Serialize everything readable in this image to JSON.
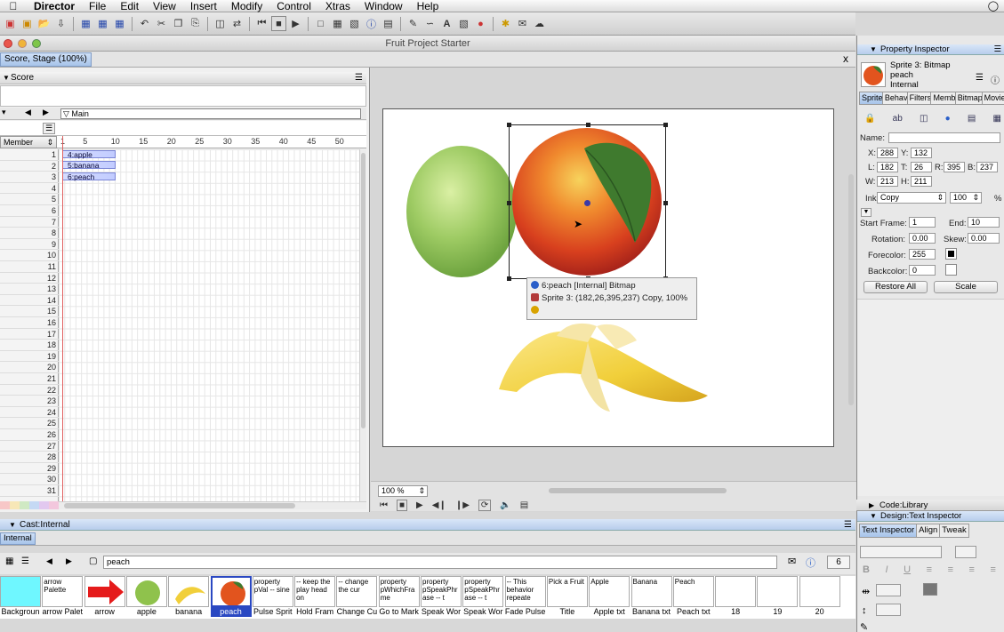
{
  "menubar": {
    "app": "Director",
    "items": [
      "File",
      "Edit",
      "View",
      "Insert",
      "Modify",
      "Control",
      "Xtras",
      "Window",
      "Help"
    ]
  },
  "window": {
    "title": "Fruit Project Starter"
  },
  "doc_tab": "Score, Stage (100%)",
  "doc_close": "x",
  "score": {
    "title": "Score",
    "marker": "Main",
    "member_btn": "Member",
    "frame_numbers": [
      "1",
      "5",
      "10",
      "15",
      "20",
      "25",
      "30",
      "35",
      "40",
      "45",
      "50"
    ],
    "channels": [
      "1",
      "2",
      "3",
      "4",
      "5",
      "6",
      "7",
      "8",
      "9",
      "10",
      "11",
      "12",
      "13",
      "14",
      "15",
      "16",
      "17",
      "18",
      "19",
      "20",
      "21",
      "22",
      "23",
      "24",
      "25",
      "26",
      "27",
      "28",
      "29",
      "30",
      "31"
    ],
    "sprites": [
      "4:apple",
      "5:banana",
      "6:peach"
    ]
  },
  "stage": {
    "zoom": "100 %",
    "tooltip": {
      "line1": "6:peach [Internal] Bitmap",
      "line2": "Sprite 3: (182,26,395,237) Copy, 100%"
    }
  },
  "property_inspector": {
    "title": "Property Inspector",
    "sprite_label": "Sprite 3: Bitmap",
    "member_name": "peach",
    "cast_name": "Internal",
    "tabs": [
      "Sprite",
      "Behav",
      "Filters",
      "Memb",
      "Bitmap",
      "Movie"
    ],
    "name_label": "Name:",
    "x_label": "X:",
    "x": "288",
    "y_label": "Y:",
    "y": "132",
    "l_label": "L:",
    "l": "182",
    "t_label": "T:",
    "t": "26",
    "r_label": "R:",
    "r": "395",
    "b_label": "B:",
    "b": "237",
    "w_label": "W:",
    "w": "213",
    "h_label": "H:",
    "h": "211",
    "ink_label": "Ink:",
    "ink": "Copy",
    "blend": "100",
    "blend_unit": "%",
    "start_label": "Start Frame:",
    "start": "1",
    "end_label": "End:",
    "end": "10",
    "rot_label": "Rotation:",
    "rotation": "0.00",
    "skew_label": "Skew:",
    "skew": "0.00",
    "fore_label": "Forecolor:",
    "forecolor": "255",
    "back_label": "Backcolor:",
    "backcolor": "0",
    "restore_btn": "Restore All",
    "scale_btn": "Scale"
  },
  "code_library": "Code:Library",
  "text_inspector": {
    "title": "Design:Text Inspector",
    "tabs": [
      "Text Inspector",
      "Align",
      "Tweak"
    ]
  },
  "cast": {
    "title": "Cast:Internal",
    "tab": "Internal",
    "search": "peach",
    "count": "6",
    "members": [
      {
        "name": "Backgroun",
        "thumb": ""
      },
      {
        "name": "arrow Palet",
        "thumb": "arrow Palette"
      },
      {
        "name": "arrow",
        "thumb": ""
      },
      {
        "name": "apple",
        "thumb": ""
      },
      {
        "name": "banana",
        "thumb": ""
      },
      {
        "name": "peach",
        "thumb": ""
      },
      {
        "name": "Pulse Sprit",
        "thumb": "property pVal -- sine"
      },
      {
        "name": "Hold Fram",
        "thumb": "-- keep the play head on"
      },
      {
        "name": "Change Cu",
        "thumb": "-- change the cur"
      },
      {
        "name": "Go to Mark",
        "thumb": "property pWhichFra me"
      },
      {
        "name": "Speak Wor",
        "thumb": "property pSpeakPhr ase -- t"
      },
      {
        "name": "Speak Wor",
        "thumb": "property pSpeakPhr ase -- t"
      },
      {
        "name": "Fade Pulse",
        "thumb": "-- This behavior repeate"
      },
      {
        "name": "Title",
        "thumb": "Pick a Fruit"
      },
      {
        "name": "Apple txt",
        "thumb": "Apple"
      },
      {
        "name": "Banana txt",
        "thumb": "Banana"
      },
      {
        "name": "Peach txt",
        "thumb": "Peach"
      },
      {
        "name": "18",
        "thumb": ""
      },
      {
        "name": "19",
        "thumb": ""
      },
      {
        "name": "20",
        "thumb": ""
      }
    ]
  }
}
